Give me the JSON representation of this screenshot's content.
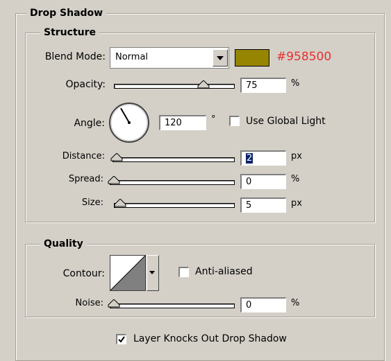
{
  "panel": {
    "title": "Drop Shadow",
    "structure": {
      "title": "Structure",
      "blend_mode_label": "Blend Mode:",
      "blend_mode_value": "Normal",
      "color": "#958500",
      "color_label": "#958500",
      "opacity_label": "Opacity:",
      "opacity_value": "75",
      "opacity_unit": "%",
      "opacity_level": 0.75,
      "angle_label": "Angle:",
      "angle_value": "120",
      "angle_unit": "°",
      "angle_degrees": 120,
      "use_global_light_label": "Use Global Light",
      "use_global_light_checked": false,
      "distance_label": "Distance:",
      "distance_value": "2",
      "distance_unit": "px",
      "spread_label": "Spread:",
      "spread_value": "0",
      "spread_unit": "%",
      "size_label": "Size:",
      "size_value": "5",
      "size_unit": "px"
    },
    "quality": {
      "title": "Quality",
      "contour_label": "Contour:",
      "anti_aliased_label": "Anti-aliased",
      "anti_aliased_checked": false,
      "noise_label": "Noise:",
      "noise_value": "0",
      "noise_unit": "%"
    },
    "layer_knocks_out_label": "Layer Knocks Out Drop Shadow",
    "layer_knocks_out_checked": true
  },
  "colors": {
    "panel_bg": "#d4d0c8",
    "color_label_text": "#e8302f",
    "selection": "#0a246a"
  }
}
